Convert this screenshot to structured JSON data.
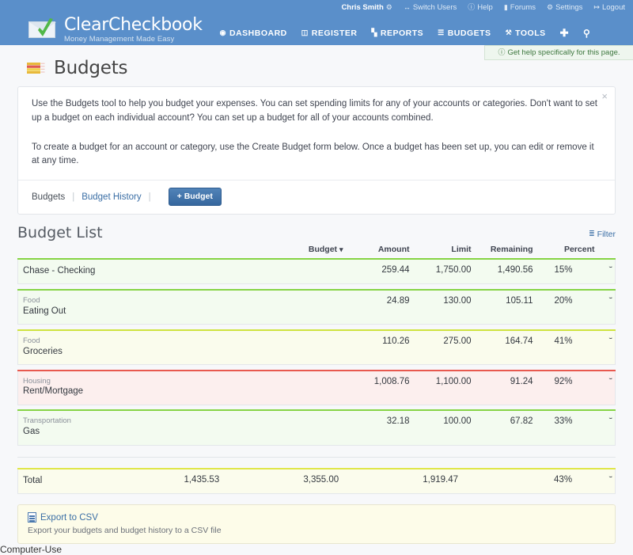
{
  "header": {
    "brand_name": "ClearCheckbook",
    "tagline": "Money Management Made Easy",
    "user": {
      "name": "Chris Smith",
      "gear_icon": "gear-icon"
    },
    "user_links": [
      {
        "label": "Switch Users",
        "icon": "switch-users-icon"
      },
      {
        "label": "Help",
        "icon": "help-circle-icon"
      },
      {
        "label": "Forums",
        "icon": "comment-icon"
      },
      {
        "label": "Settings",
        "icon": "gear-icon"
      },
      {
        "label": "Logout",
        "icon": "logout-icon"
      }
    ],
    "nav": [
      {
        "label": "DASHBOARD",
        "icon": "dashboard-circle-icon"
      },
      {
        "label": "REGISTER",
        "icon": "register-book-icon"
      },
      {
        "label": "REPORTS",
        "icon": "bar-chart-icon"
      },
      {
        "label": "BUDGETS",
        "icon": "list-lines-icon"
      },
      {
        "label": "TOOLS",
        "icon": "wrench-icon"
      },
      {
        "label": "",
        "icon": "plus-icon"
      },
      {
        "label": "",
        "icon": "search-icon"
      }
    ],
    "accent_color": "#5a8fca"
  },
  "help_strip": {
    "icon": "help-circle-icon",
    "text": "Get help specifically for this page."
  },
  "page": {
    "title": "Budgets",
    "title_icon": "money-bills-icon"
  },
  "info_panel": {
    "paragraph_1": "Use the Budgets tool to help you budget your expenses. You can set spending limits for any of your accounts or categories. Don't want to set up a budget on each individual account? You can set up a budget for all of your accounts combined.",
    "paragraph_2": "To create a budget for an account or category, use the Create Budget form below. Once a budget has been set up, you can edit or remove it at any time.",
    "close_label": "×"
  },
  "tabs": {
    "current": "Budgets",
    "separator": "|",
    "history_label": "Budget History",
    "new_budget_label": "+ Budget"
  },
  "budget_list": {
    "title": "Budget List",
    "filter_label": "Filter",
    "filter_icon": "filter-lines-icon",
    "columns": {
      "budget": "Budget",
      "budget_sort_icon": "chevron-down-icon",
      "amount": "Amount",
      "limit": "Limit",
      "remaining": "Remaining",
      "percent": "Percent"
    },
    "rows": [
      {
        "category": "",
        "name": "Chase - Checking",
        "amount": "259.44",
        "limit": "1,750.00",
        "remaining": "1,490.56",
        "percent": "15%",
        "level": "lv-green",
        "accent": "#86d445",
        "expand_icon": "double-chevron-down-icon"
      },
      {
        "category": "Food",
        "name": "Eating Out",
        "amount": "24.89",
        "limit": "130.00",
        "remaining": "105.11",
        "percent": "20%",
        "level": "lv-green",
        "accent": "#86d445",
        "expand_icon": "double-chevron-down-icon"
      },
      {
        "category": "Food",
        "name": "Groceries",
        "amount": "110.26",
        "limit": "275.00",
        "remaining": "164.74",
        "percent": "41%",
        "level": "lv-yellow",
        "accent": "#cfe33f",
        "expand_icon": "double-chevron-down-icon"
      },
      {
        "category": "Housing",
        "name": "Rent/Mortgage",
        "amount": "1,008.76",
        "limit": "1,100.00",
        "remaining": "91.24",
        "percent": "92%",
        "level": "lv-red",
        "accent": "#e8594f",
        "expand_icon": "double-chevron-down-icon"
      },
      {
        "category": "Transportation",
        "name": "Gas",
        "amount": "32.18",
        "limit": "100.00",
        "remaining": "67.82",
        "percent": "33%",
        "level": "lv-green",
        "accent": "#86d445",
        "expand_icon": "double-chevron-down-icon"
      }
    ],
    "total": {
      "category": "",
      "name": "Total",
      "amount": "1,435.53",
      "limit": "3,355.00",
      "remaining": "1,919.47",
      "percent": "43%",
      "level": "lv-total",
      "accent": "#e0e64a",
      "expand_icon": "double-chevron-down-icon"
    }
  },
  "export": {
    "icon": "csv-file-icon",
    "link_label": "Export to CSV",
    "note": "Export your budgets and budget history to a CSV file"
  }
}
